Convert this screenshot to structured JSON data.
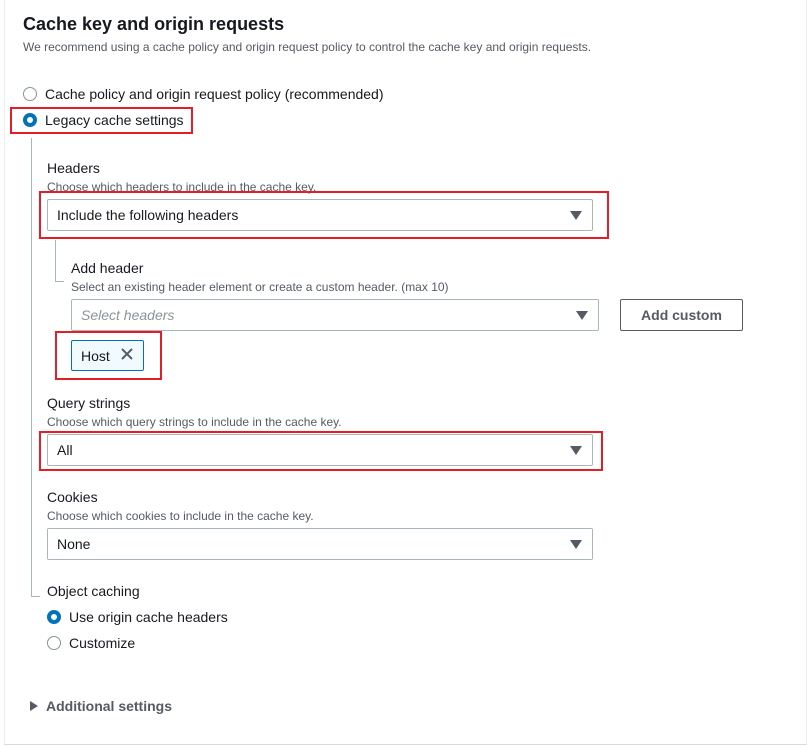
{
  "section": {
    "title": "Cache key and origin requests",
    "description": "We recommend using a cache policy and origin request policy to control the cache key and origin requests."
  },
  "cache_mode": {
    "options": [
      {
        "label": "Cache policy and origin request policy (recommended)",
        "selected": false
      },
      {
        "label": "Legacy cache settings",
        "selected": true
      }
    ]
  },
  "headers": {
    "label": "Headers",
    "description": "Choose which headers to include in the cache key.",
    "value": "Include the following headers",
    "add_header": {
      "label": "Add header",
      "description": "Select an existing header element or create a custom header. (max 10)",
      "placeholder": "Select headers",
      "add_custom_label": "Add custom",
      "tokens": [
        {
          "label": "Host"
        }
      ]
    }
  },
  "query_strings": {
    "label": "Query strings",
    "description": "Choose which query strings to include in the cache key.",
    "value": "All"
  },
  "cookies": {
    "label": "Cookies",
    "description": "Choose which cookies to include in the cache key.",
    "value": "None"
  },
  "object_caching": {
    "label": "Object caching",
    "options": [
      {
        "label": "Use origin cache headers",
        "selected": true
      },
      {
        "label": "Customize",
        "selected": false
      }
    ]
  },
  "additional_settings": {
    "label": "Additional settings",
    "expanded": false
  },
  "colors": {
    "accent": "#0073bb",
    "highlight": "#e41e26",
    "text": "#16191f",
    "muted": "#545b64"
  }
}
